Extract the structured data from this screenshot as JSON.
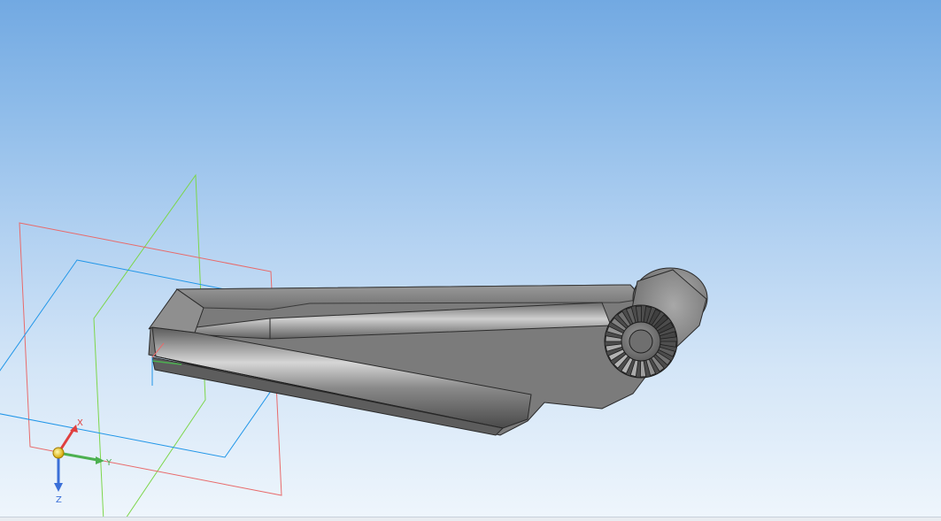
{
  "viewport": {
    "background_top": "#72a9e2",
    "background_bottom": "#eff6fc"
  },
  "planes": {
    "xy_color": "#2196e8",
    "xz_color": "#e86a6a",
    "yz_color": "#7cd64a"
  },
  "part": {
    "body_color": "#7d7d7d",
    "highlight_color": "#b8b8b8",
    "edge_color": "#2a2a2a"
  },
  "triad": {
    "x_label": "X",
    "y_label": "Y",
    "z_label": "Z",
    "x_color": "#e04040",
    "y_color": "#4cb050",
    "z_color": "#3a6fd8",
    "origin_color": "#f0d030"
  },
  "icons": [
    "origin-icon"
  ]
}
